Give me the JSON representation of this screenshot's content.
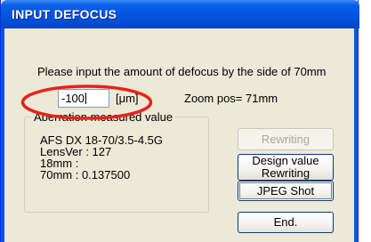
{
  "window": {
    "title": "INPUT DEFOCUS"
  },
  "prompt": {
    "text": "Please input the amount of defocus by the side of   70mm"
  },
  "defocus_input": {
    "value": "-100",
    "unit": "[μm]"
  },
  "zoom": {
    "text": "Zoom pos= 71mm"
  },
  "aberration": {
    "legend": "Aberration measured value",
    "lines": [
      "AFS DX 18-70/3.5-4.5G",
      "LensVer : 127",
      " 18mm :",
      " 70mm : 0.137500"
    ]
  },
  "buttons": {
    "rewriting": "Rewriting",
    "design_line1": "Design value",
    "design_line2": "Rewriting",
    "jpeg": "JPEG Shot",
    "end": "End."
  },
  "colors": {
    "highlight": "#e8231a",
    "titlebar": "#0554e0",
    "face": "#ece9d8"
  }
}
